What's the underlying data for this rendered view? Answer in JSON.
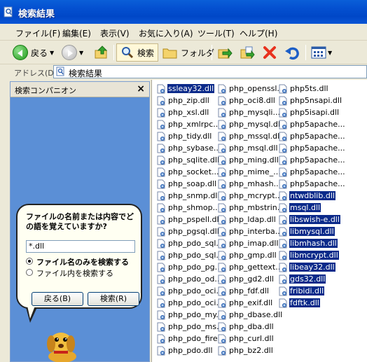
{
  "window": {
    "title": "検索結果"
  },
  "menu": [
    "ファイル(F)",
    "編集(E)",
    "表示(V)",
    "お気に入り(A)",
    "ツール(T)",
    "ヘルプ(H)"
  ],
  "toolbar": {
    "back": "戻る",
    "search": "検索",
    "folders": "フォルダ"
  },
  "address": {
    "label": "アドレス(D)",
    "value": "検索結果"
  },
  "companion": {
    "title": "検索コンパニオン",
    "close": "×",
    "question": "ファイルの名前または内容でどの語を覚えていますか?",
    "input_value": "*.dll",
    "option_name_only": "ファイル名のみを検索する",
    "option_content": "ファイル内を検索する",
    "back_button": "戻る(B)",
    "search_button": "検索(R)"
  },
  "files": {
    "col1": [
      "ssleay32.dll",
      "php_zip.dll",
      "php_xsl.dll",
      "php_xmlrpc....",
      "php_tidy.dll",
      "php_sybase....",
      "php_sqlite.dll",
      "php_socket....",
      "php_soap.dll",
      "php_snmp.dll",
      "php_shmop....",
      "php_pspell.dll",
      "php_pgsql.dll",
      "php_pdo_sql...",
      "php_pdo_sql...",
      "php_pdo_pg...",
      "php_pdo_od...",
      "php_pdo_oci...",
      "php_pdo_oci...",
      "php_pdo_my...",
      "php_pdo_ms...",
      "php_pdo_fire...",
      "php_pdo.dll"
    ],
    "col2": [
      "php_openssl....",
      "php_oci8.dll",
      "php_mysqli....",
      "php_mysql.dll",
      "php_mssql.dll",
      "php_msql.dll",
      "php_ming.dll",
      "php_mime_...",
      "php_mhash....",
      "php_mcrypt....",
      "php_mbstrin...",
      "php_ldap.dll",
      "php_interba...",
      "php_imap.dll",
      "php_gmp.dll",
      "php_gettext....",
      "php_gd2.dll",
      "php_fdf.dll",
      "php_exif.dll",
      "php_dbase.dll",
      "php_dba.dll",
      "php_curl.dll",
      "php_bz2.dll"
    ],
    "col3": [
      "php5ts.dll",
      "php5nsapi.dll",
      "php5isapi.dll",
      "php5apache...",
      "php5apache...",
      "php5apache...",
      "php5apache...",
      "php5apache...",
      "php5apache...",
      "ntwdblib.dll",
      "msql.dll",
      "libswish-e.dll",
      "libmysql.dll",
      "libmhash.dll",
      "libmcrypt.dll",
      "libeay32.dll",
      "gds32.dll",
      "fribidi.dll",
      "fdftk.dll"
    ],
    "col1_selected": [
      0
    ],
    "col3_selected": [
      9,
      10,
      11,
      12,
      13,
      14,
      15,
      16,
      17,
      18
    ]
  }
}
